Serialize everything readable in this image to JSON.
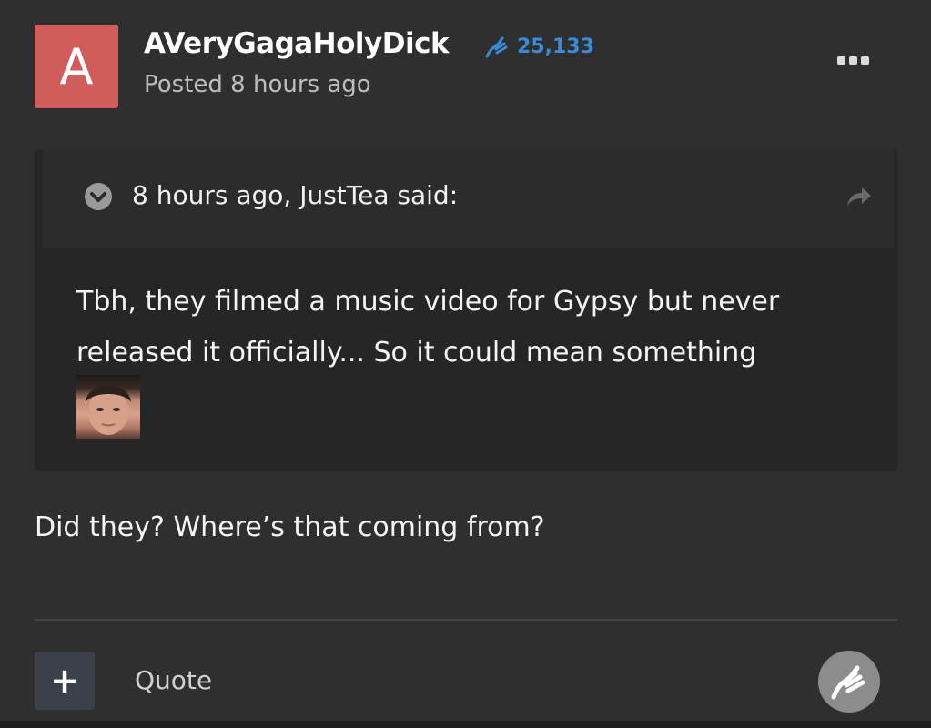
{
  "post": {
    "avatar_letter": "A",
    "avatar_color": "#d05c5c",
    "username": "AVeryGagaHolyDick",
    "reputation": "25,133",
    "reputation_color": "#3a8ad6",
    "posted": "Posted 8 hours ago",
    "more_icon": "ellipsis-icon"
  },
  "quote": {
    "citation": "8 hours ago, JustTea said:",
    "text": "Tbh, they filmed a music video for Gypsy but never released it officially... So it could mean something",
    "toggle_icon": "chevron-down-icon",
    "share_icon": "share-arrow-icon"
  },
  "reply": {
    "text": "Did they? Where’s that coming from?"
  },
  "footer": {
    "add_label": "+",
    "quote_label": "Quote",
    "react_icon": "paws-up-icon"
  }
}
